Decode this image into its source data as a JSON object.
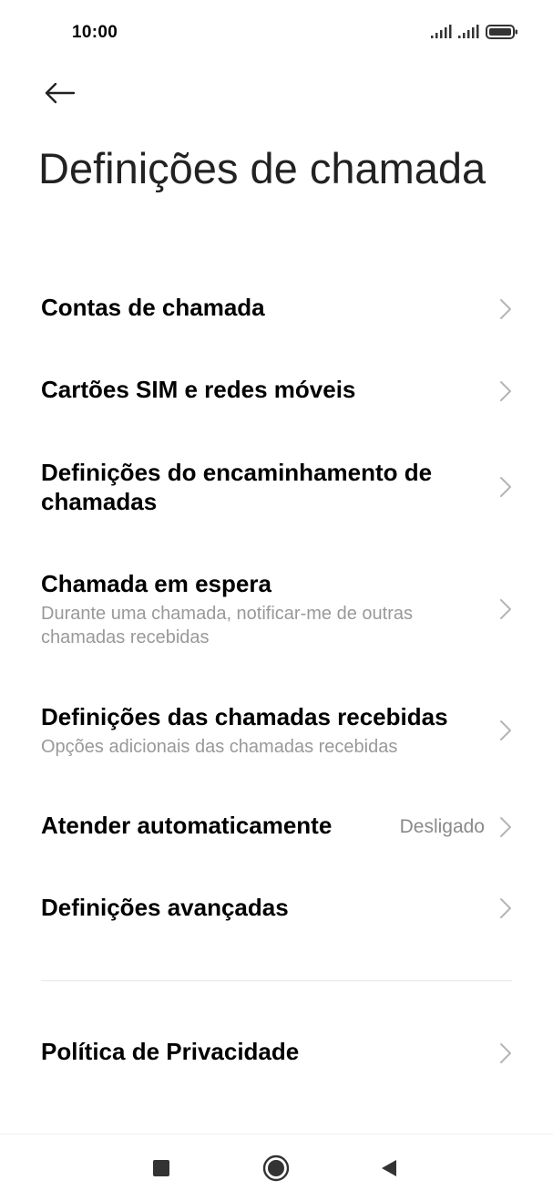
{
  "status_bar": {
    "time": "10:00",
    "icons": [
      "signal-icon",
      "signal-icon",
      "battery-icon"
    ]
  },
  "header": {
    "back_icon": "arrow-left-icon",
    "title": "Definições de chamada"
  },
  "settings": {
    "items": [
      {
        "title": "Contas de chamada"
      },
      {
        "title": "Cartões SIM e redes móveis"
      },
      {
        "title": "Definições do encaminhamento de chamadas"
      },
      {
        "title": "Chamada em espera",
        "subtitle": "Durante uma chamada, notificar-me de outras chamadas recebidas"
      },
      {
        "title": "Definições das chamadas recebidas",
        "subtitle": "Opções adicionais das chamadas recebidas"
      },
      {
        "title": "Atender automaticamente",
        "value": "Desligado"
      },
      {
        "title": "Definições avançadas"
      },
      {
        "title": "Política de Privacidade"
      }
    ]
  },
  "nav_bar": {
    "icons": [
      "recent-apps-icon",
      "home-icon",
      "back-triangle-icon"
    ]
  }
}
